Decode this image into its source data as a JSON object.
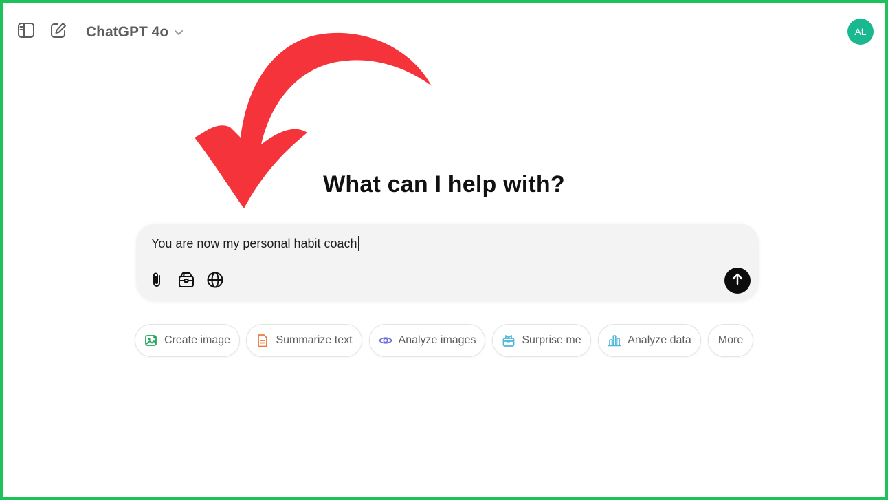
{
  "header": {
    "model_name": "ChatGPT 4o",
    "avatar_initials": "AL",
    "avatar_color": "#19b88f",
    "sidebar_toggle_icon": "sidebar-icon",
    "new_chat_icon": "new-chat-icon",
    "model_chevron_icon": "chevron-down-icon"
  },
  "main": {
    "heading": "What can I help with?"
  },
  "composer": {
    "value": "You are now my personal habit coach",
    "tools": [
      {
        "icon": "paperclip-icon"
      },
      {
        "icon": "toolbox-icon"
      },
      {
        "icon": "globe-icon"
      }
    ],
    "send_icon": "arrow-up-icon"
  },
  "suggestions": [
    {
      "label": "Create image",
      "icon": "image-icon",
      "color": "#22a55a"
    },
    {
      "label": "Summarize text",
      "icon": "document-icon",
      "color": "#ec7a3c"
    },
    {
      "label": "Analyze images",
      "icon": "eye-icon",
      "color": "#6b6bdc"
    },
    {
      "label": "Surprise me",
      "icon": "gift-icon",
      "color": "#4cb8d8"
    },
    {
      "label": "Analyze data",
      "icon": "bar-chart-icon",
      "color": "#4cb8d8"
    },
    {
      "label": "More",
      "icon": "",
      "color": "#5d5d5d"
    }
  ],
  "annotation": {
    "arrow_color": "#f5333a",
    "icon": "curved-arrow-annotation"
  },
  "colors": {
    "frame_border": "#1fc15a"
  }
}
